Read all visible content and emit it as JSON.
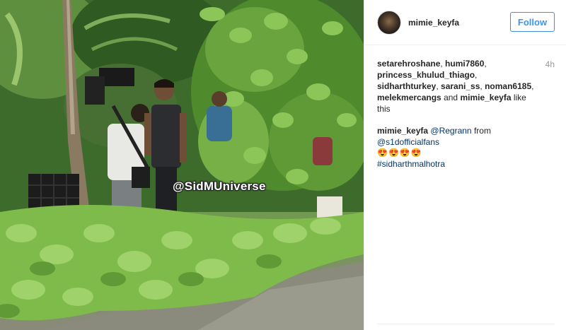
{
  "post": {
    "watermark": "@SidMUniverse"
  },
  "header": {
    "username": "mimie_keyfa",
    "follow_label": "Follow"
  },
  "likes": {
    "users": [
      "setarehroshane",
      "humi7860",
      "princess_khulud_thiago",
      "sidharthturkey",
      "sarani_ss",
      "noman6185",
      "melekmercangs",
      "mimie_keyfa"
    ],
    "and_text": "and",
    "suffix": "like this"
  },
  "time": "4h",
  "caption": {
    "user": "mimie_keyfa",
    "mention_regrann": "@Regrann",
    "from_text": "from",
    "mention_source": "@s1dofficialfans",
    "emojis": "😍😍😍😍",
    "hashtag": "#sidharthmalhotra"
  },
  "colors": {
    "follow_blue": "#3897f0",
    "link_navy": "#003569",
    "time_gray": "#999999"
  }
}
